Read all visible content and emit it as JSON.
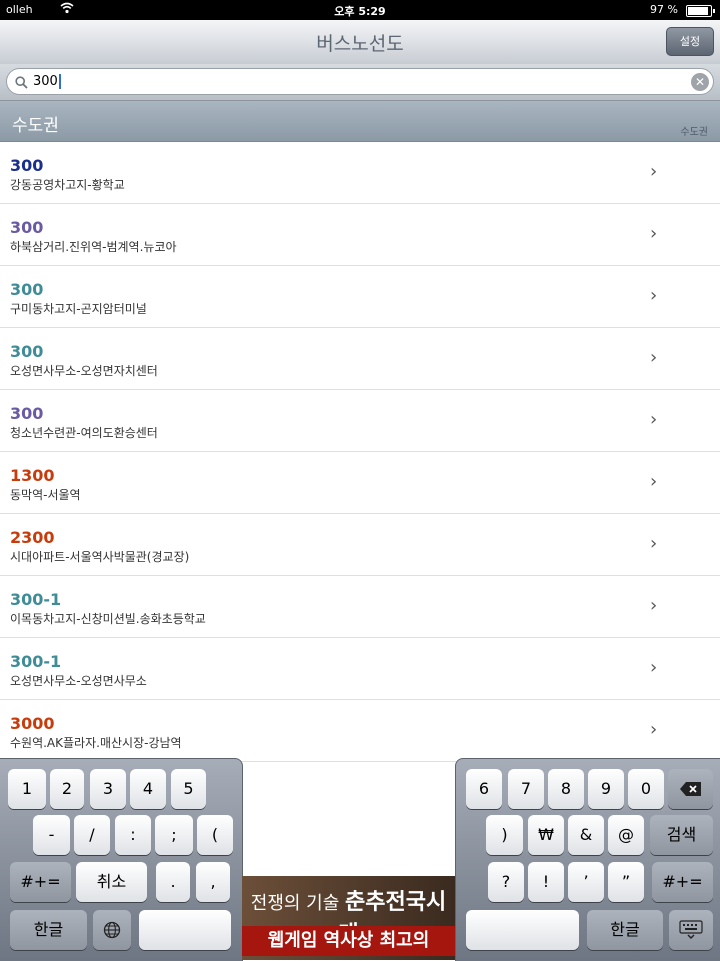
{
  "status": {
    "carrier": "olleh",
    "time": "오후 5:29",
    "battery": "97 %"
  },
  "nav": {
    "title": "버스노선도",
    "settings_label": "설정"
  },
  "search": {
    "value": "300"
  },
  "section": {
    "label": "수도권",
    "index_label": "수도권"
  },
  "colors": {
    "blue": "#1a2f8c",
    "purple": "#6a5aa3",
    "teal": "#3d8c96",
    "red": "#c83c0c"
  },
  "routes": [
    {
      "number": "300",
      "desc": "강동공영차고지-황학교",
      "color": "#1a2f8c"
    },
    {
      "number": "300",
      "desc": "하북삼거리.진위역-범계역.뉴코아",
      "color": "#6a5aa3"
    },
    {
      "number": "300",
      "desc": "구미동차고지-곤지암터미널",
      "color": "#3d8c96"
    },
    {
      "number": "300",
      "desc": "오성면사무소-오성면자치센터",
      "color": "#3d8c96"
    },
    {
      "number": "300",
      "desc": "청소년수련관-여의도환승센터",
      "color": "#6a5aa3"
    },
    {
      "number": "1300",
      "desc": "동막역-서울역",
      "color": "#c83c0c"
    },
    {
      "number": "2300",
      "desc": "시대아파트-서울역사박물관(경교장)",
      "color": "#c83c0c"
    },
    {
      "number": "300-1",
      "desc": "이목동차고지-신창미션빌.송화초등학교",
      "color": "#3d8c96"
    },
    {
      "number": "300-1",
      "desc": "오성면사무소-오성면사무소",
      "color": "#3d8c96"
    },
    {
      "number": "3000",
      "desc": "수원역.AK플라자.매산시장-강남역",
      "color": "#c83c0c"
    }
  ],
  "keyboard": {
    "left": {
      "row1": [
        "1",
        "2",
        "3",
        "4",
        "5"
      ],
      "row2": [
        "-",
        "/",
        ":",
        ";",
        "("
      ],
      "row3": [
        "#+=",
        "취소",
        ".",
        ","
      ],
      "row4": [
        "한글"
      ]
    },
    "right": {
      "row1": [
        "6",
        "7",
        "8",
        "9",
        "0"
      ],
      "row2": [
        ")",
        "₩",
        "&",
        "@",
        "검색"
      ],
      "row3": [
        "?",
        "!",
        "’",
        "”",
        "#+="
      ],
      "row4": [
        "한글"
      ]
    }
  },
  "ad": {
    "line1_a": "전쟁의 기술",
    "line1_b": "춘추전국시대",
    "line2": "웹게임 역사상 최고의"
  }
}
